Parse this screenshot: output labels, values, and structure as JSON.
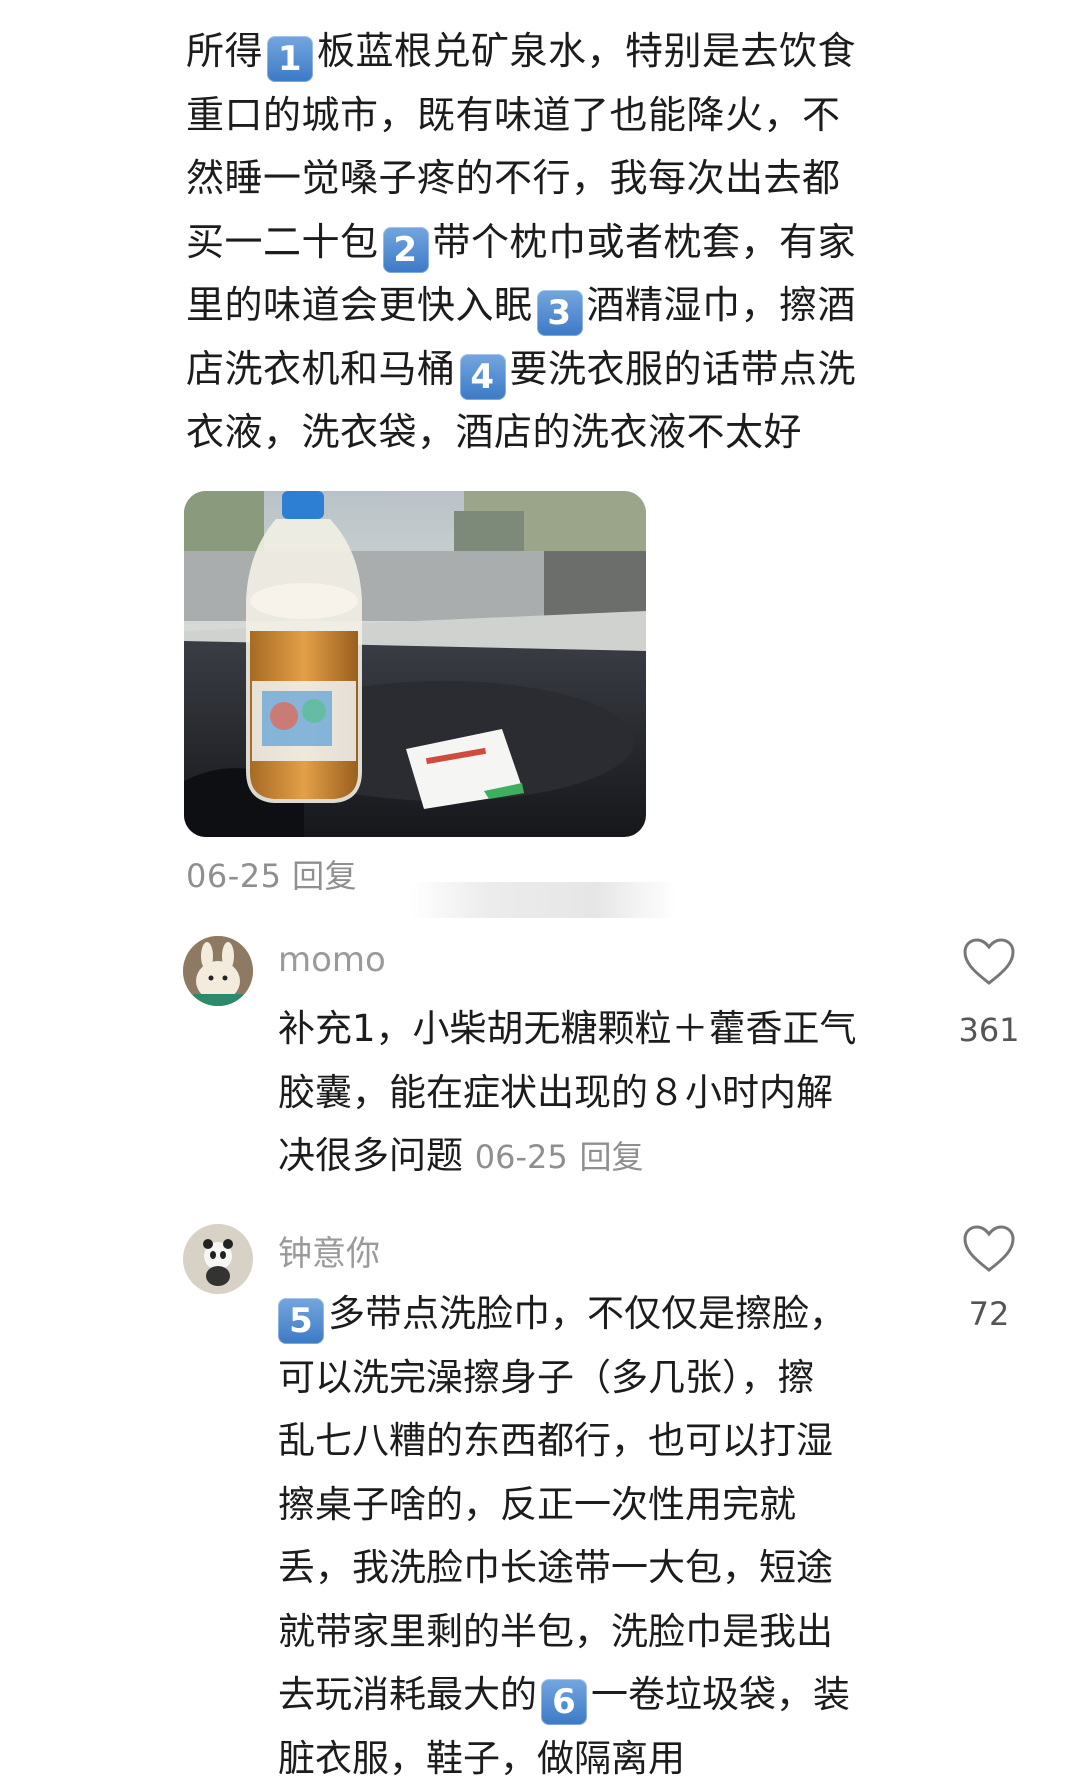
{
  "post": {
    "lines": [
      {
        "pre": "所得",
        "badge": "1",
        "post": "板蓝根兑矿泉水，特别是去饮食"
      },
      {
        "pre": "重口的城市，既有味道了也能降火，不",
        "badge": "",
        "post": ""
      },
      {
        "pre": "然睡一觉嗓子疼的不行，我每次出去都",
        "badge": "",
        "post": ""
      },
      {
        "pre": "买一二十包",
        "badge": "2",
        "post": "带个枕巾或者枕套，有家"
      },
      {
        "pre": "里的味道会更快入眠",
        "badge": "3",
        "post": "酒精湿巾，擦酒"
      },
      {
        "pre": "店洗衣机和马桶",
        "badge": "4",
        "post": "要洗衣服的话带点洗"
      },
      {
        "pre": "衣液，洗衣袋，酒店的洗衣液不太好",
        "badge": "",
        "post": ""
      }
    ],
    "date": "06-25",
    "reply": "回复"
  },
  "comments": [
    {
      "username": "momo",
      "likes": "361",
      "lines": [
        {
          "pre": "补充1，小柴胡无糖颗粒＋藿香正气",
          "badge": "",
          "post": ""
        },
        {
          "pre": "胶囊，能在症状出现的８小时内解",
          "badge": "",
          "post": ""
        },
        {
          "pre": "决很多问题 ",
          "badge": "",
          "post": ""
        }
      ],
      "date": "06-25",
      "reply": "回复"
    },
    {
      "username": "钟意你",
      "likes": "72",
      "lines": [
        {
          "pre": "",
          "badge": "5",
          "post": "多带点洗脸巾，不仅仅是擦脸，"
        },
        {
          "pre": "可以洗完澡擦身子（多几张），擦",
          "badge": "",
          "post": ""
        },
        {
          "pre": "乱七八糟的东西都行，也可以打湿",
          "badge": "",
          "post": ""
        },
        {
          "pre": "擦桌子啥的，反正一次性用完就",
          "badge": "",
          "post": ""
        },
        {
          "pre": "丢，我洗脸巾长途带一大包，短途",
          "badge": "",
          "post": ""
        },
        {
          "pre": "就带家里剩的半包，洗脸巾是我出",
          "badge": "",
          "post": ""
        },
        {
          "pre": "去玩消耗最大的",
          "badge": "6",
          "post": "一卷垃圾袋，装"
        },
        {
          "pre": "脏衣服，鞋子，做隔离用",
          "badge": "",
          "post": ""
        }
      ]
    }
  ],
  "icons": {
    "like": "heart-outline-icon",
    "badge_color": "#4a86cf"
  }
}
